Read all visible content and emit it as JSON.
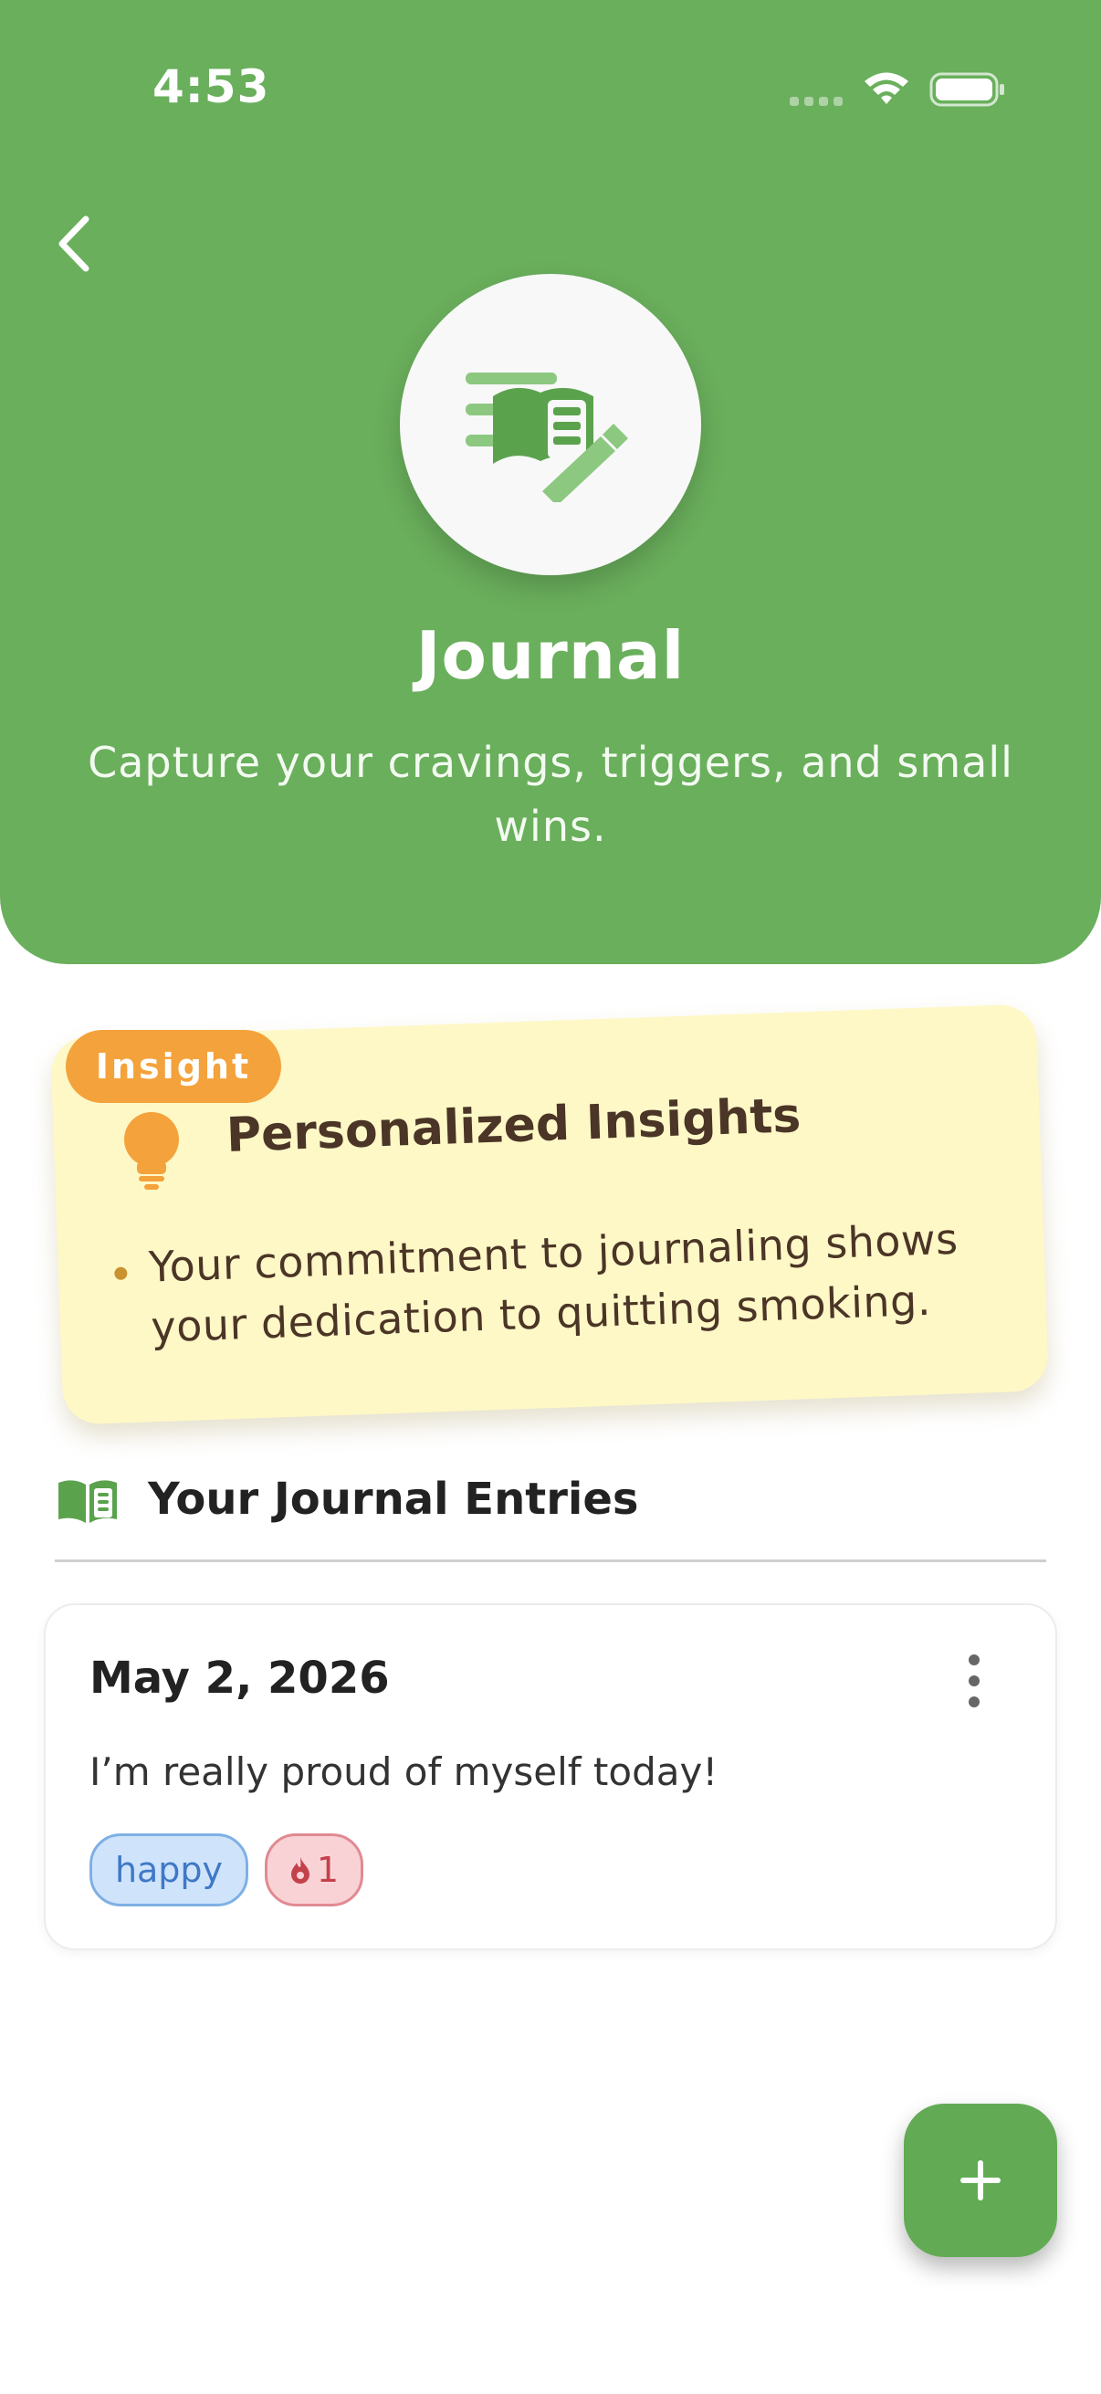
{
  "status_bar": {
    "time": "4:53"
  },
  "header": {
    "title": "Journal",
    "subtitle": "Capture your cravings, triggers, and small wins."
  },
  "insight": {
    "badge": "Insight",
    "title": "Personalized Insights",
    "bullets": [
      "Your commitment to journaling shows your dedication to quitting smoking."
    ]
  },
  "entries": {
    "heading": "Your Journal Entries",
    "items": [
      {
        "date": "May 2, 2026",
        "text": "I’m really proud of myself today!",
        "mood": "happy",
        "craving_count": "1"
      }
    ]
  },
  "colors": {
    "header_green": "#6aaf5c",
    "insight_background": "#fef8c7",
    "insight_badge": "#f4a23b",
    "mood_tag": "#cfe4fb",
    "craving_tag": "#f9d2d6"
  },
  "icons": {
    "back": "chevron-left-icon",
    "hero": "journal-writing-icon",
    "insight": "lightbulb-icon",
    "entries": "open-book-icon",
    "menu": "more-vertical-icon",
    "craving": "flame-icon",
    "add": "plus-icon"
  }
}
